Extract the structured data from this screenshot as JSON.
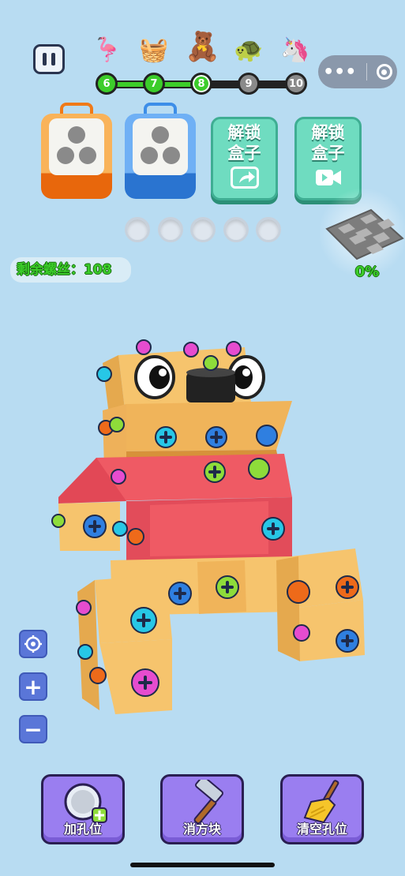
{
  "header": {
    "pause_icon": "pause-icon",
    "capsule_more": "•••",
    "capsule_close_icon": "target-icon"
  },
  "levels": [
    {
      "number": "6",
      "icon": "flamingo",
      "glyph": "🦩",
      "state": "done"
    },
    {
      "number": "7",
      "icon": "flower-basket",
      "glyph": "🧺",
      "state": "done"
    },
    {
      "number": "8",
      "icon": "teddy-bear",
      "glyph": "🧸",
      "state": "current"
    },
    {
      "number": "9",
      "icon": "turtle",
      "glyph": "🐢",
      "state": "locked"
    },
    {
      "number": "10",
      "icon": "unicorn",
      "glyph": "🦄",
      "state": "locked"
    }
  ],
  "boxes": [
    {
      "color": "#f07a18",
      "handle": "#f07a18"
    },
    {
      "color": "#3d8ee8",
      "handle": "#3d8ee8"
    }
  ],
  "unlock_buttons": [
    {
      "line1": "解锁",
      "line2": "盒子",
      "icon": "share-icon"
    },
    {
      "line1": "解锁",
      "line2": "盒子",
      "icon": "video-icon"
    }
  ],
  "holes_count": 5,
  "remaining_label": "剩余螺丝：108",
  "progress_percent": "0%",
  "side_controls": [
    "locate-icon",
    "zoom-in-icon",
    "zoom-out-icon"
  ],
  "side_glyphs": {
    "zoom_in": "+",
    "zoom_out": "−"
  },
  "tools": [
    {
      "label": "加孔位",
      "icon": "add-hole-icon"
    },
    {
      "label": "消方块",
      "icon": "hammer-icon"
    },
    {
      "label": "清空孔位",
      "icon": "broom-icon"
    }
  ],
  "colors": {
    "background": "#b8dcf2",
    "level_done": "#3ccd2a",
    "level_locked": "#8a8a8a",
    "accent_teal": "#6fdcc0",
    "tool_purple": "#9a7ef0"
  }
}
